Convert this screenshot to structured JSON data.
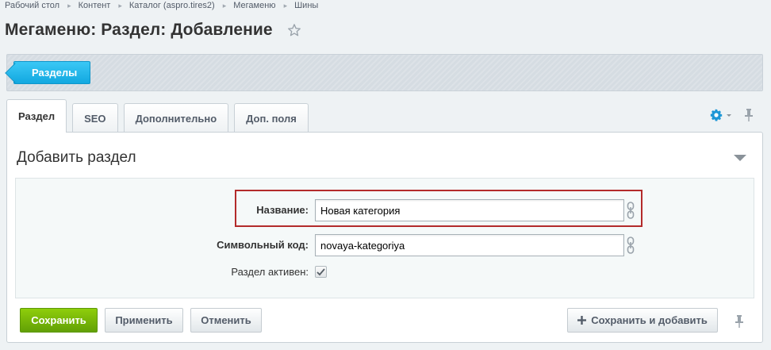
{
  "breadcrumb": [
    "Рабочий стол",
    "Контент",
    "Каталог (aspro.tires2)",
    "Мегаменю",
    "Шины"
  ],
  "page_title": "Мегаменю: Раздел: Добавление",
  "toolbar": {
    "sections_button": "Разделы"
  },
  "tabs": [
    {
      "label": "Раздел",
      "active": true
    },
    {
      "label": "SEO",
      "active": false
    },
    {
      "label": "Дополнительно",
      "active": false
    },
    {
      "label": "Доп. поля",
      "active": false
    }
  ],
  "panel": {
    "title": "Добавить раздел"
  },
  "form": {
    "name_label": "Название:",
    "name_value": "Новая категория",
    "code_label": "Символьный код:",
    "code_value": "novaya-kategoriya",
    "active_label": "Раздел активен:",
    "active_checked": true
  },
  "buttons": {
    "save": "Сохранить",
    "apply": "Применить",
    "cancel": "Отменить",
    "save_and_add": "Сохранить и добавить"
  },
  "colors": {
    "accent_blue": "#12a8e0",
    "save_green": "#62a006",
    "highlight_red": "#b32b2b"
  },
  "icons": [
    "star-icon",
    "gear-icon",
    "pin-icon",
    "chain-link-icon",
    "checkmark-icon",
    "plus-icon",
    "collapse-arrow-icon"
  ]
}
